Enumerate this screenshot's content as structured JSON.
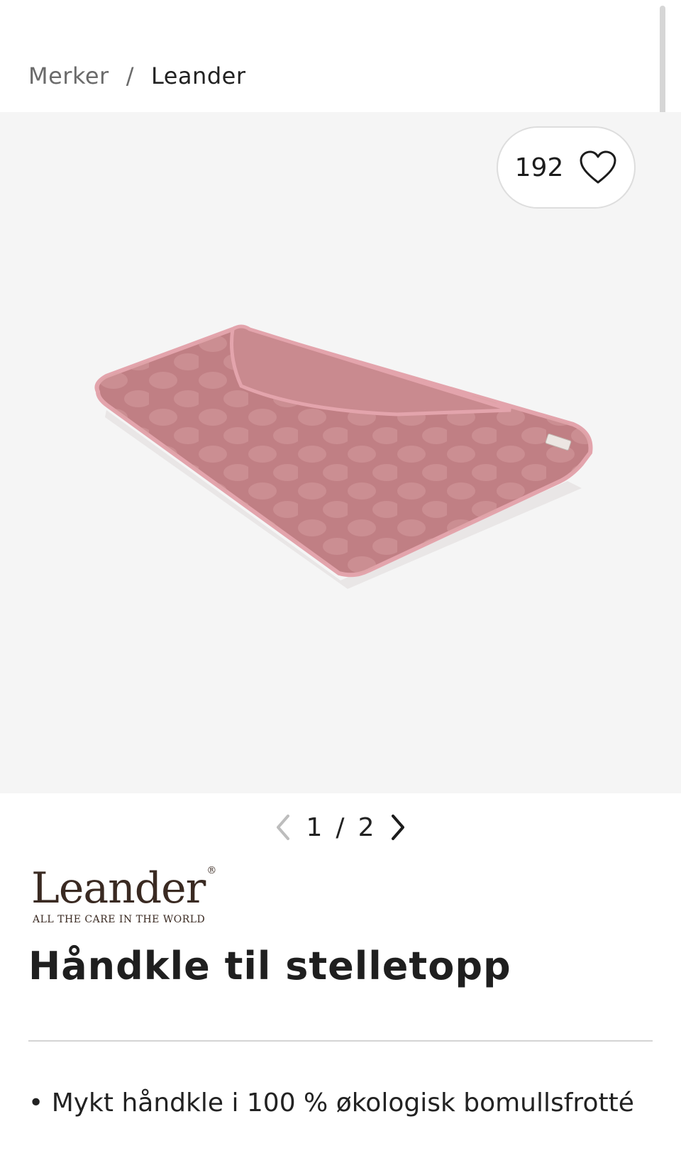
{
  "breadcrumb": {
    "parent": "Merker",
    "separator": "/",
    "current": "Leander"
  },
  "favorites": {
    "count": "192",
    "icon": "heart-outline-icon"
  },
  "gallery": {
    "current": "1",
    "separator": "/",
    "total": "2",
    "image_alt": "pink-towel-product-image",
    "towel_color": "#c07f84",
    "towel_dot_color": "#d9a1a3",
    "towel_edge_color": "#e3a4ac"
  },
  "brand": {
    "name": "Leander",
    "registered": "®",
    "tagline": "ALL THE CARE IN THE WORLD"
  },
  "product": {
    "title": "Håndkle til stelletopp",
    "features": [
      "Mykt håndkle i 100 % økologisk bomullsfrotté"
    ]
  }
}
